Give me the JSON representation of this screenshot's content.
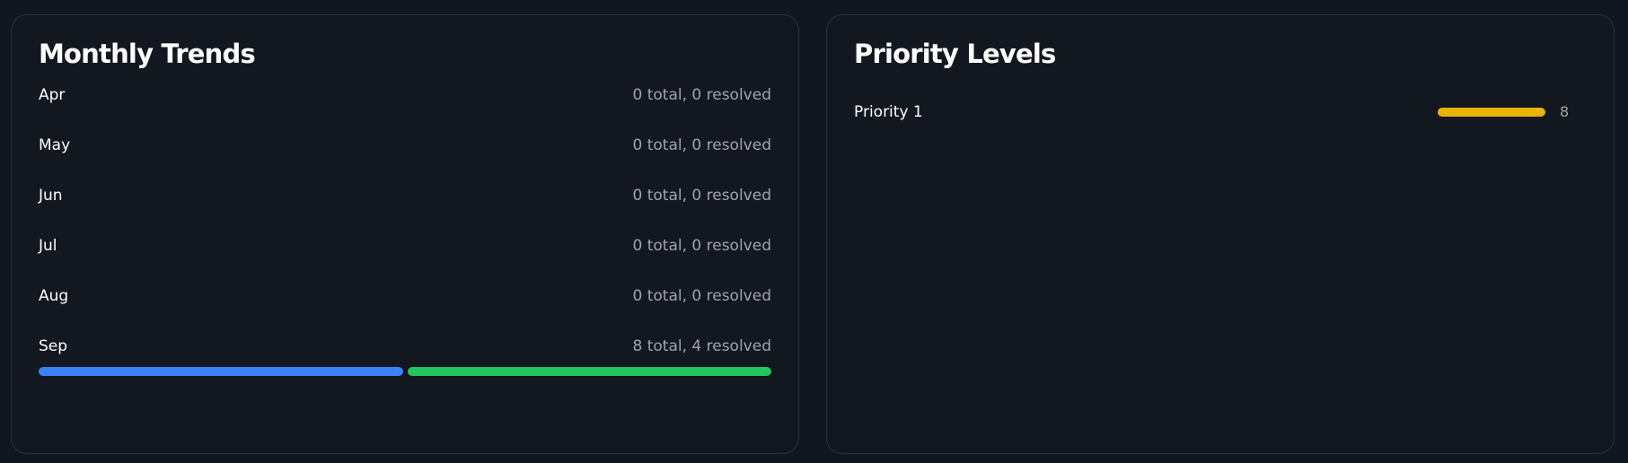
{
  "monthly_trends": {
    "title": "Monthly Trends",
    "colors": {
      "total": "#3b82f6",
      "resolved": "#22c55e"
    },
    "months": [
      {
        "label": "Apr",
        "stats": "0 total, 0 resolved",
        "total": 0,
        "resolved": 0
      },
      {
        "label": "May",
        "stats": "0 total, 0 resolved",
        "total": 0,
        "resolved": 0
      },
      {
        "label": "Jun",
        "stats": "0 total, 0 resolved",
        "total": 0,
        "resolved": 0
      },
      {
        "label": "Jul",
        "stats": "0 total, 0 resolved",
        "total": 0,
        "resolved": 0
      },
      {
        "label": "Aug",
        "stats": "0 total, 0 resolved",
        "total": 0,
        "resolved": 0
      },
      {
        "label": "Sep",
        "stats": "8 total, 4 resolved",
        "total": 8,
        "resolved": 4
      }
    ]
  },
  "priority_levels": {
    "title": "Priority Levels",
    "items": [
      {
        "label": "Priority 1",
        "count": "8",
        "value": 8,
        "color": "#eab308"
      }
    ]
  }
}
